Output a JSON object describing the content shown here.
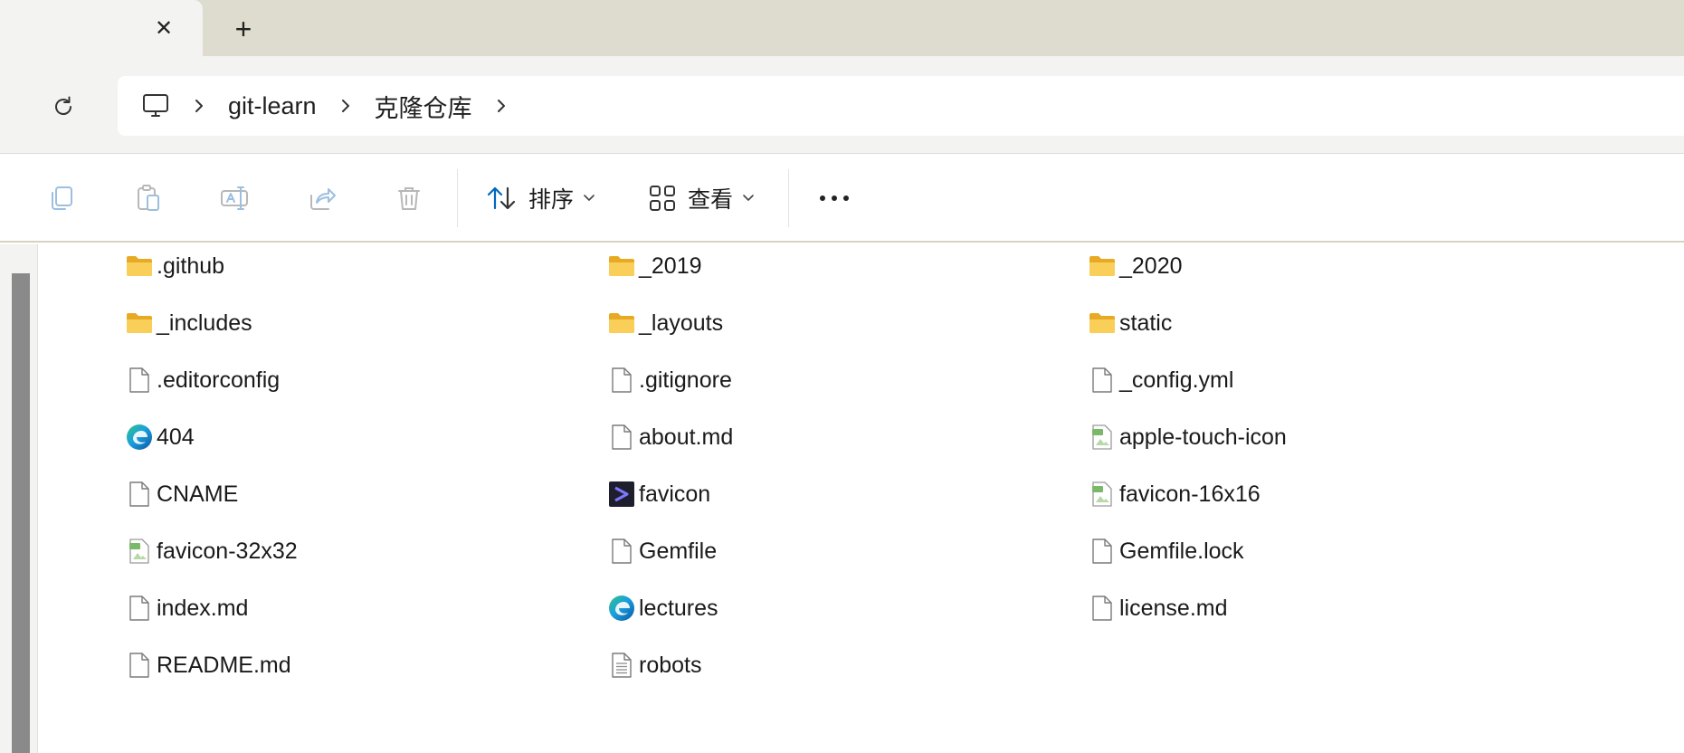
{
  "tabstrip": {
    "close_glyph": "✕",
    "new_tab_glyph": "+"
  },
  "address": {
    "breadcrumbs": [
      "git-learn",
      "克隆仓库"
    ]
  },
  "commandbar": {
    "sort_label": "排序",
    "view_label": "查看"
  },
  "files": {
    "columns": [
      [
        {
          "name": ".github",
          "icon": "folder-icon"
        },
        {
          "name": "_includes",
          "icon": "folder-icon"
        },
        {
          "name": ".editorconfig",
          "icon": "file-icon"
        },
        {
          "name": "404",
          "icon": "edge-icon"
        },
        {
          "name": "CNAME",
          "icon": "file-icon"
        },
        {
          "name": "favicon-32x32",
          "icon": "png-file-icon"
        },
        {
          "name": "index.md",
          "icon": "file-icon"
        },
        {
          "name": "README.md",
          "icon": "file-icon"
        }
      ],
      [
        {
          "name": "_2019",
          "icon": "folder-icon"
        },
        {
          "name": "_layouts",
          "icon": "folder-icon"
        },
        {
          "name": ".gitignore",
          "icon": "file-icon"
        },
        {
          "name": "about.md",
          "icon": "file-icon"
        },
        {
          "name": "favicon",
          "icon": "terminal-icon"
        },
        {
          "name": "Gemfile",
          "icon": "file-icon"
        },
        {
          "name": "lectures",
          "icon": "edge-icon"
        },
        {
          "name": "robots",
          "icon": "text-file-icon"
        }
      ],
      [
        {
          "name": "_2020",
          "icon": "folder-icon"
        },
        {
          "name": "static",
          "icon": "folder-icon"
        },
        {
          "name": "_config.yml",
          "icon": "file-icon"
        },
        {
          "name": "apple-touch-icon",
          "icon": "png-file-icon"
        },
        {
          "name": "favicon-16x16",
          "icon": "png-file-icon"
        },
        {
          "name": "Gemfile.lock",
          "icon": "file-icon"
        },
        {
          "name": "license.md",
          "icon": "file-icon"
        }
      ]
    ]
  },
  "colors": {
    "tabstrip_bg": "#dedccf",
    "toolbar_bg": "#f3f3f1",
    "folder_yellow": "#f7c948",
    "accent_blue": "#0067c0"
  }
}
